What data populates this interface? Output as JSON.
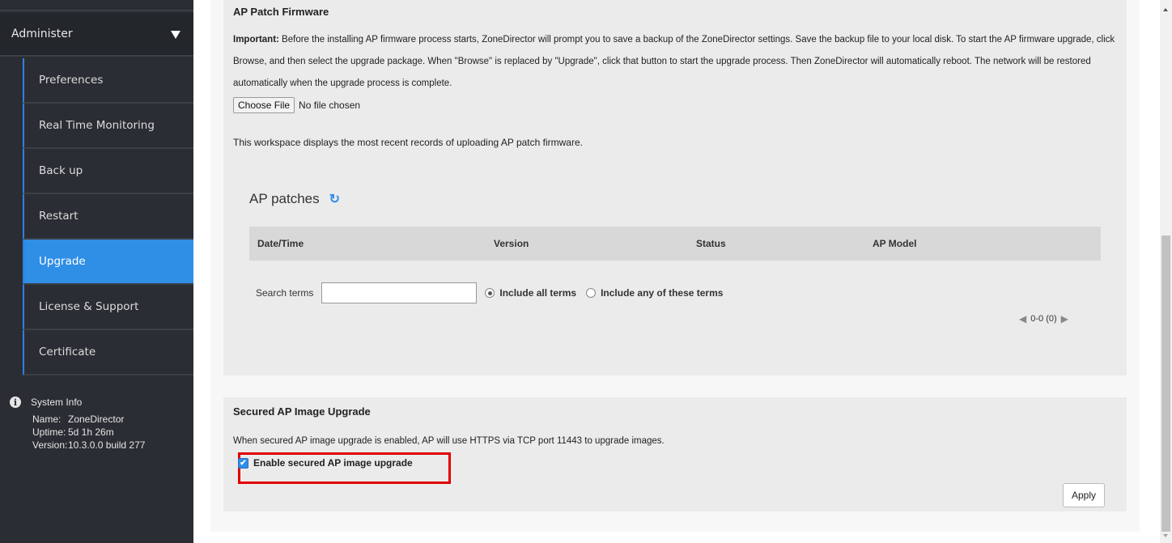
{
  "sidebar": {
    "section_title": "Administer",
    "items": [
      {
        "label": "Preferences"
      },
      {
        "label": "Real Time Monitoring"
      },
      {
        "label": "Back up"
      },
      {
        "label": "Restart"
      },
      {
        "label": "Upgrade",
        "active": true
      },
      {
        "label": "License & Support"
      },
      {
        "label": "Certificate"
      }
    ],
    "system_info": {
      "title": "System Info",
      "name_key": "Name:",
      "name_value": "ZoneDirector",
      "uptime_key": "Uptime:",
      "uptime_value": "5d 1h 26m",
      "version_key": "Version:",
      "version_value": "10.3.0.0 build 277"
    }
  },
  "patch_firmware": {
    "title": "AP Patch Firmware",
    "important_label": "Important:",
    "description": " Before the installing AP firmware process starts, ZoneDirector will prompt you to save a backup of the ZoneDirector settings. Save the backup file to your local disk. To start the AP firmware upgrade, click Browse, and then select the upgrade package. When \"Browse\" is replaced by \"Upgrade\", click that button to start the upgrade process. Then ZoneDirector will automatically reboot. The network will be restored automatically when the upgrade process is complete.",
    "choose_file_label": "Choose File",
    "no_file_text": "No file chosen",
    "workspace_note": "This workspace displays the most recent records of uploading AP patch firmware."
  },
  "ap_patches": {
    "title": "AP patches",
    "columns": [
      "Date/Time",
      "Version",
      "Status",
      "AP Model"
    ],
    "search_label": "Search terms",
    "search_value": "",
    "radio_all": "Include all terms",
    "radio_any": "Include any of these terms",
    "pager_text": "0-0 (0)"
  },
  "secured_upgrade": {
    "title": "Secured AP Image Upgrade",
    "description": "When secured AP image upgrade is enabled, AP will use HTTPS via TCP port 11443 to upgrade images.",
    "checkbox_label": "Enable secured AP image upgrade",
    "checked": true,
    "apply_label": "Apply"
  },
  "colors": {
    "sidebar_bg": "#2a2d33",
    "active_item": "#2f8ee6",
    "highlight_border": "#e00000",
    "panel_bg": "#ebebeb"
  }
}
